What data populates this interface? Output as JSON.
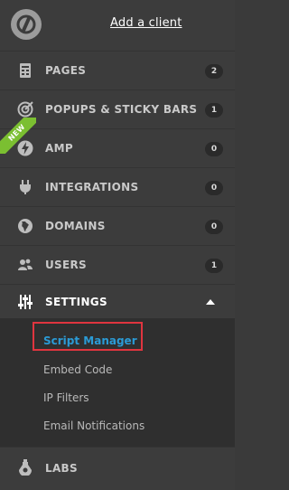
{
  "header": {
    "add_client_label": "Add a client"
  },
  "nav": [
    {
      "label": "PAGES",
      "badge": "2",
      "icon": "pages-icon"
    },
    {
      "label": "POPUPS & STICKY BARS",
      "badge": "1",
      "icon": "target-icon"
    },
    {
      "label": "AMP",
      "badge": "0",
      "icon": "lightning-icon",
      "ribbon": "NEW"
    },
    {
      "label": "INTEGRATIONS",
      "badge": "0",
      "icon": "plug-icon"
    },
    {
      "label": "DOMAINS",
      "badge": "0",
      "icon": "globe-icon"
    },
    {
      "label": "USERS",
      "badge": "1",
      "icon": "users-icon"
    },
    {
      "label": "SETTINGS",
      "icon": "sliders-icon"
    },
    {
      "label": "LABS",
      "icon": "flask-icon"
    }
  ],
  "settings_submenu": [
    {
      "label": "Script Manager"
    },
    {
      "label": "Embed Code"
    },
    {
      "label": "IP Filters"
    },
    {
      "label": "Email Notifications"
    }
  ],
  "colors": {
    "accent": "#2b9bd6",
    "highlight": "#e0353f",
    "ribbon": "#7bbf31"
  }
}
